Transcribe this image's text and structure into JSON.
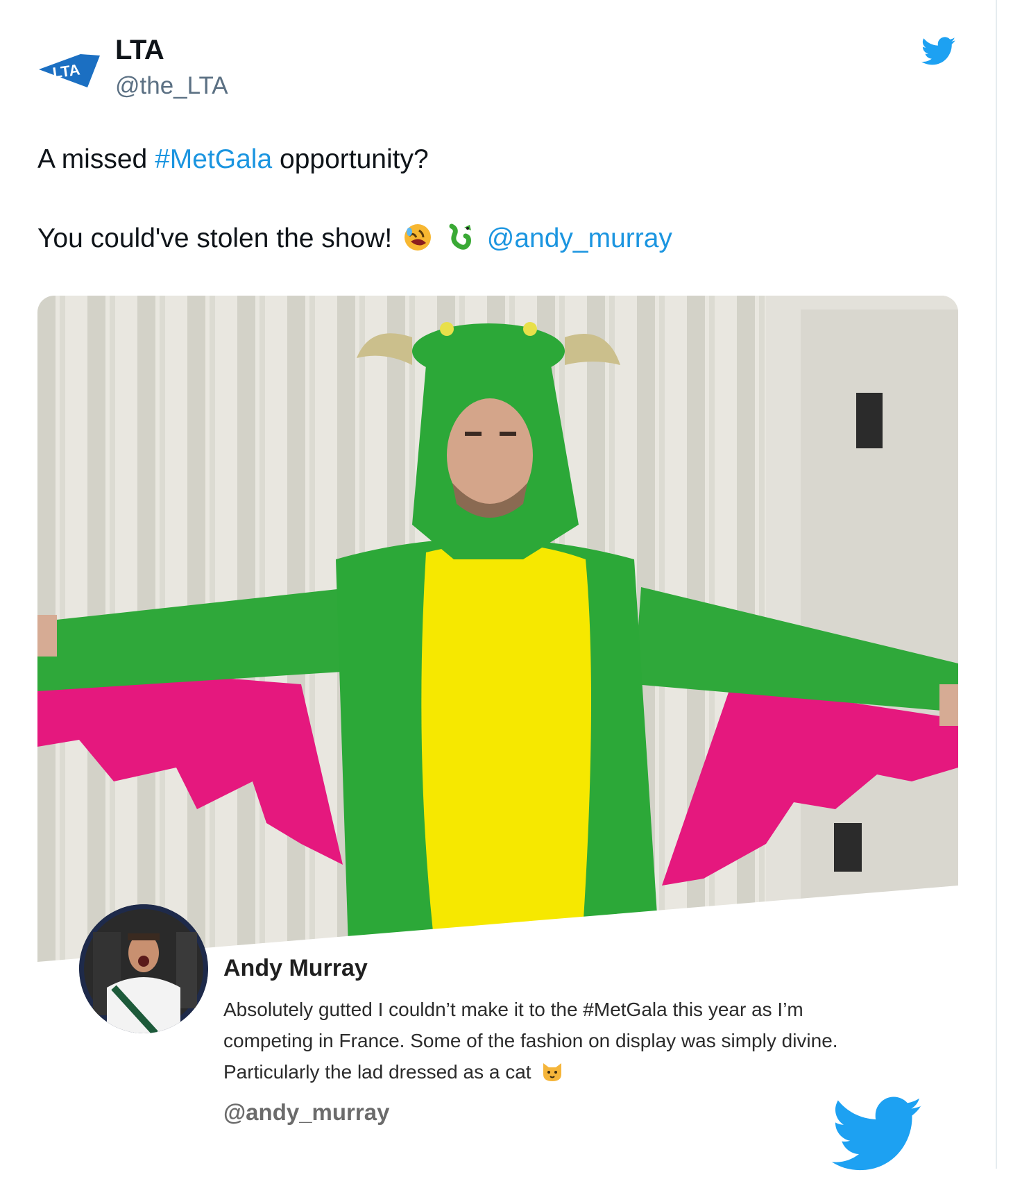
{
  "tweet": {
    "display_name": "LTA",
    "handle": "@the_LTA",
    "logo_text": "LTA",
    "text_line1_before": "A missed ",
    "text_line1_hashtag": "#MetGala",
    "text_line1_after": " opportunity?",
    "text_line2": "You could've stolen the show!",
    "text_line2_mention": "@andy_murray",
    "emojis": [
      "rolling-on-floor-laughing-emoji",
      "dragon-emoji"
    ],
    "link_color": "#1b95e0"
  },
  "quoted_post": {
    "name": "Andy Murray",
    "body": "Absolutely gutted I couldn’t make it to the #MetGala this year as I’m competing in France. Some of the fashion on display was simply divine. Particularly the lad dressed as a cat",
    "body_emoji": "cat-face-emoji",
    "handle": "@andy_murray"
  },
  "icons": {
    "header": "twitter-bird-icon",
    "footer": "twitter-bird-icon",
    "brand_color": "#1da1f2"
  }
}
